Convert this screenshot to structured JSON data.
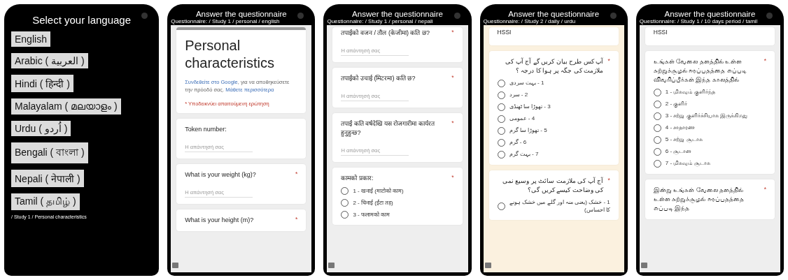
{
  "phones": [
    {
      "kind": "language_menu",
      "title": "Select your language",
      "languages": [
        "English",
        "Arabic ( العربية )",
        "Hindi ( हिन्दी )",
        "Malayalam ( മലയാളം )",
        "Urdu ( اُردو )",
        "Bengali ( বাংলা )",
        "Nepali ( नेपाली )",
        "Tamil ( தமிழ் )"
      ],
      "path": "/ Study 1 / Personal characteristics"
    },
    {
      "kind": "form",
      "title": "Answer the questionnaire",
      "subtitle": "Questionnaire: / Study 1 / personal / english",
      "color": "#eeeeee",
      "blocks": [
        {
          "kind": "header",
          "title": "Personal characteristics",
          "signin_link": "Συνδεθείτε στο Google",
          "signin_text": ", για να αποθηκεύσετε την πρόοδό σας.",
          "learn_more": "Μάθετε περισσότερα",
          "required_note": "* Υποδεικνύει απαιτούμενη ερώτηση"
        },
        {
          "kind": "text",
          "question": "Token number:",
          "placeholder": "Η απάντησή σας"
        },
        {
          "kind": "text",
          "question": "What is your weight (kg)?",
          "mark": "*",
          "placeholder": "Η απάντησή σας"
        },
        {
          "kind": "text",
          "question": "What is your height (m)?",
          "mark": "*"
        }
      ]
    },
    {
      "kind": "form",
      "title": "Answer the questionnaire",
      "subtitle": "Questionnaire: / Study 1 / personal / nepali",
      "color": "#eeeeee",
      "blocks": [
        {
          "kind": "text",
          "question": "तपाईंको वजन / तौल (केजीमा) कति छ?",
          "mark": "*",
          "placeholder": "Η απάντησή σας",
          "cut": true
        },
        {
          "kind": "text",
          "question": "तपाईंको उचाई (मिटरमा) कति छ?",
          "mark": "*",
          "placeholder": "Η απάντησή σας"
        },
        {
          "kind": "text",
          "question": "तपाईं कति वर्षदेखि यस रोजगारीमा कार्यरत हुनुहुन्छ?",
          "mark": "*",
          "placeholder": "Η απάντησή σας"
        },
        {
          "kind": "choice",
          "question": "कामको प्रकार:",
          "mark": "*",
          "options": [
            {
              "label": "1 - खनाई (माटोको काम)",
              "selected": false
            },
            {
              "label": "2 - चिनाई (ईंटा तह)",
              "selected": false
            },
            {
              "label": "3 - फलामको काम",
              "selected": false
            }
          ]
        }
      ]
    },
    {
      "kind": "form",
      "title": "Answer the questionnaire",
      "subtitle": "Questionnaire: / Study 2 / daily / urdu",
      "color": "#fbf1df",
      "blocks": [
        {
          "kind": "label",
          "text": "HSSI"
        },
        {
          "kind": "choice",
          "question": "آپ کس طرح بیان کریں گے آج آپ کی ملازمت کی جگہ پر ہوا کا درجہ ؟",
          "mark": "*",
          "options": [
            {
              "label": "1 - بہت سردی",
              "selected": false
            },
            {
              "label": "2 - سرد",
              "selected": false
            },
            {
              "label": "3 - تھوڑا سا ٹھنڈی",
              "selected": false
            },
            {
              "label": "4 - عمومی",
              "selected": false
            },
            {
              "label": "5 - تھوڑا سا گرم",
              "selected": false
            },
            {
              "label": "6 - گرم",
              "selected": false
            },
            {
              "label": "7 - بہت گرم",
              "selected": false
            }
          ]
        },
        {
          "kind": "choice",
          "question": "آج آپ کی ملازمت سائٹ پر وسیع نمی کی وضاحت کیسے کریں گی؟",
          "mark": "*",
          "options": [
            {
              "label": "1 - خشک (یعنی منہ اور گلے میں خشک ہونے کا احساس)",
              "selected": false
            }
          ]
        }
      ]
    },
    {
      "kind": "form",
      "title": "Answer the questionnaire",
      "subtitle": "Questionnaire: / Study 1 / 10 days period / tamil",
      "color": "#eeeeee",
      "blocks": [
        {
          "kind": "label",
          "text": "HSSI"
        },
        {
          "kind": "choice",
          "question": "உங்கள் வேலை தளத்தில் உள்ள சுற்றுச்சூழல் ஈரப்பதத்தை எப்படி விவரிப்பீர்கள் இந்த காலத்தில்",
          "mark": "*",
          "options": [
            {
              "label": "1 - மிகவும் குளிர்ந்த",
              "selected": false
            },
            {
              "label": "2 - குளிர்",
              "selected": false
            },
            {
              "label": "3 - சற்று குளிர்ச்சியாக இருக்கிறது",
              "selected": false
            },
            {
              "label": "4 - சாதாரண",
              "selected": false
            },
            {
              "label": "5 - சற்று சூடாக",
              "selected": false
            },
            {
              "label": "6 - சூடான",
              "selected": false
            },
            {
              "label": "7 - மிகவும் சூடாக",
              "selected": false
            }
          ]
        },
        {
          "kind": "text",
          "question": "இன்று உங்கள் வேலை தளத்தில் உள்ள சுற்றுச்சூழல் ஈரப்பதத்தை எப்படி இந்த",
          "mark": "*"
        }
      ]
    }
  ]
}
